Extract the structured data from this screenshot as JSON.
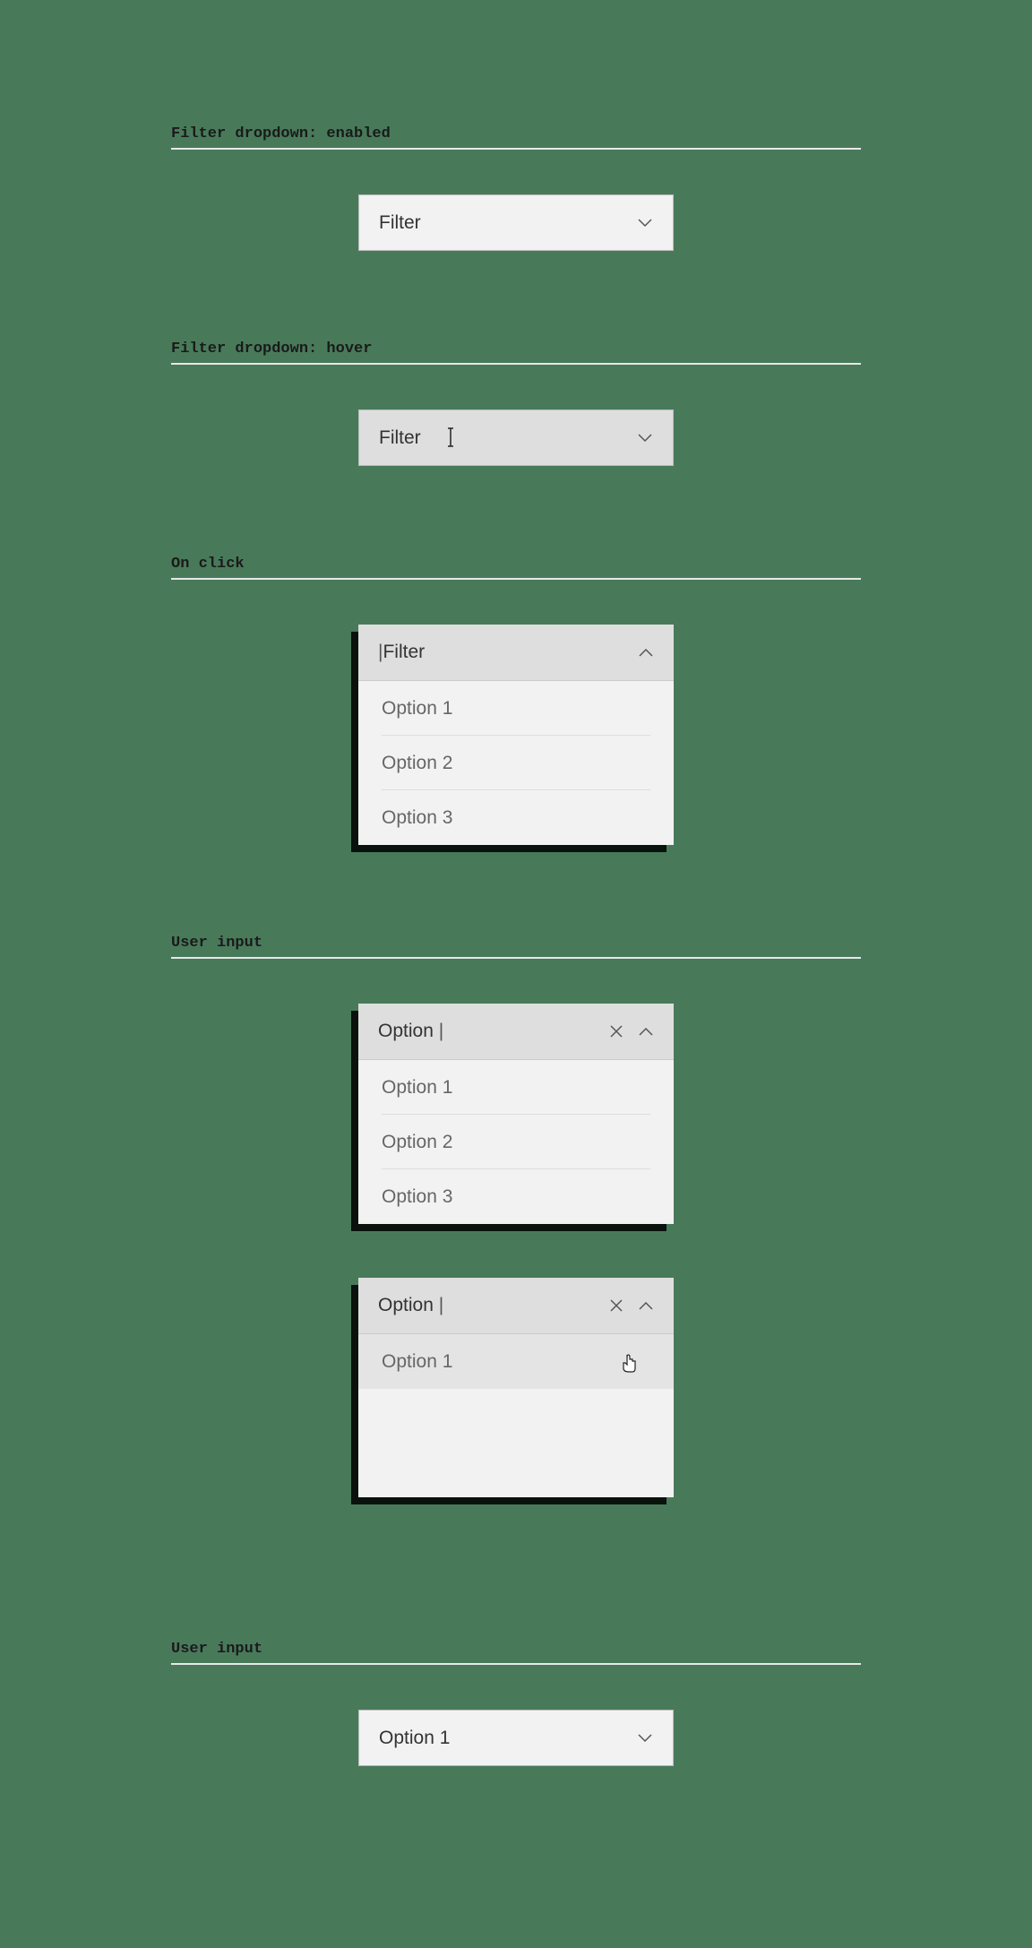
{
  "sections": {
    "enabled": {
      "label": "Filter dropdown: enabled",
      "dropdown": {
        "text": "Filter"
      }
    },
    "hover": {
      "label": "Filter dropdown: hover",
      "dropdown": {
        "text": "Filter"
      }
    },
    "onclick": {
      "label": "On click",
      "dropdown": {
        "text": "Filter",
        "options": [
          "Option 1",
          "Option 2",
          "Option 3"
        ]
      }
    },
    "userinput1": {
      "label": "User input",
      "dropdown_a": {
        "text": "Option",
        "options": [
          "Option 1",
          "Option 2",
          "Option 3"
        ]
      },
      "dropdown_b": {
        "text": "Option",
        "options": [
          "Option 1"
        ]
      }
    },
    "userinput2": {
      "label": "User input",
      "dropdown": {
        "text": "Option 1"
      }
    }
  }
}
